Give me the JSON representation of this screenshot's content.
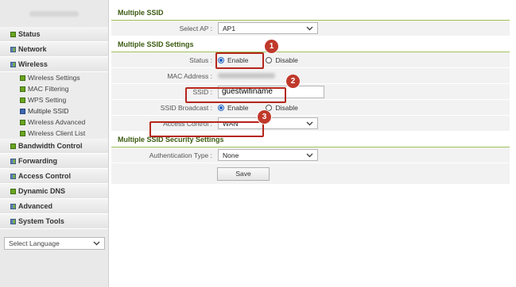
{
  "sidebar": {
    "items": [
      {
        "label": "Status",
        "icon": "square-green-icon"
      },
      {
        "label": "Network",
        "icon": "grid-icon"
      },
      {
        "label": "Wireless",
        "icon": "grid-icon"
      }
    ],
    "wireless_sub": [
      {
        "label": "Wireless Settings"
      },
      {
        "label": "MAC Filtering"
      },
      {
        "label": "WPS Setting"
      },
      {
        "label": "Multiple SSID"
      },
      {
        "label": "Wireless Advanced"
      },
      {
        "label": "Wireless Client List"
      }
    ],
    "items_after": [
      {
        "label": "Bandwidth Control"
      },
      {
        "label": "Forwarding"
      },
      {
        "label": "Access Control"
      },
      {
        "label": "Dynamic DNS"
      },
      {
        "label": "Advanced"
      },
      {
        "label": "System Tools"
      }
    ],
    "language_select": "Select Language"
  },
  "section1": {
    "title": "Multiple SSID",
    "select_ap_label": "Select AP :",
    "select_ap_value": "AP1"
  },
  "section2": {
    "title": "Multiple SSID Settings",
    "status_label": "Status :",
    "enable_label": "Enable",
    "disable_label": "Disable",
    "mac_label": "MAC Address :",
    "ssid_label": "SSID :",
    "ssid_value": "guestwifiname",
    "broadcast_label": "SSID Broadcast :",
    "access_control_label": "Access Control :",
    "access_control_value": "WAN"
  },
  "section3": {
    "title": "Multiple SSID Security Settings",
    "auth_label": "Authentication Type :",
    "auth_value": "None",
    "save_label": "Save"
  },
  "callouts": [
    "1",
    "2",
    "3"
  ],
  "colors": {
    "accent_green": "#6ba51f",
    "callout_red": "#c0392b"
  }
}
